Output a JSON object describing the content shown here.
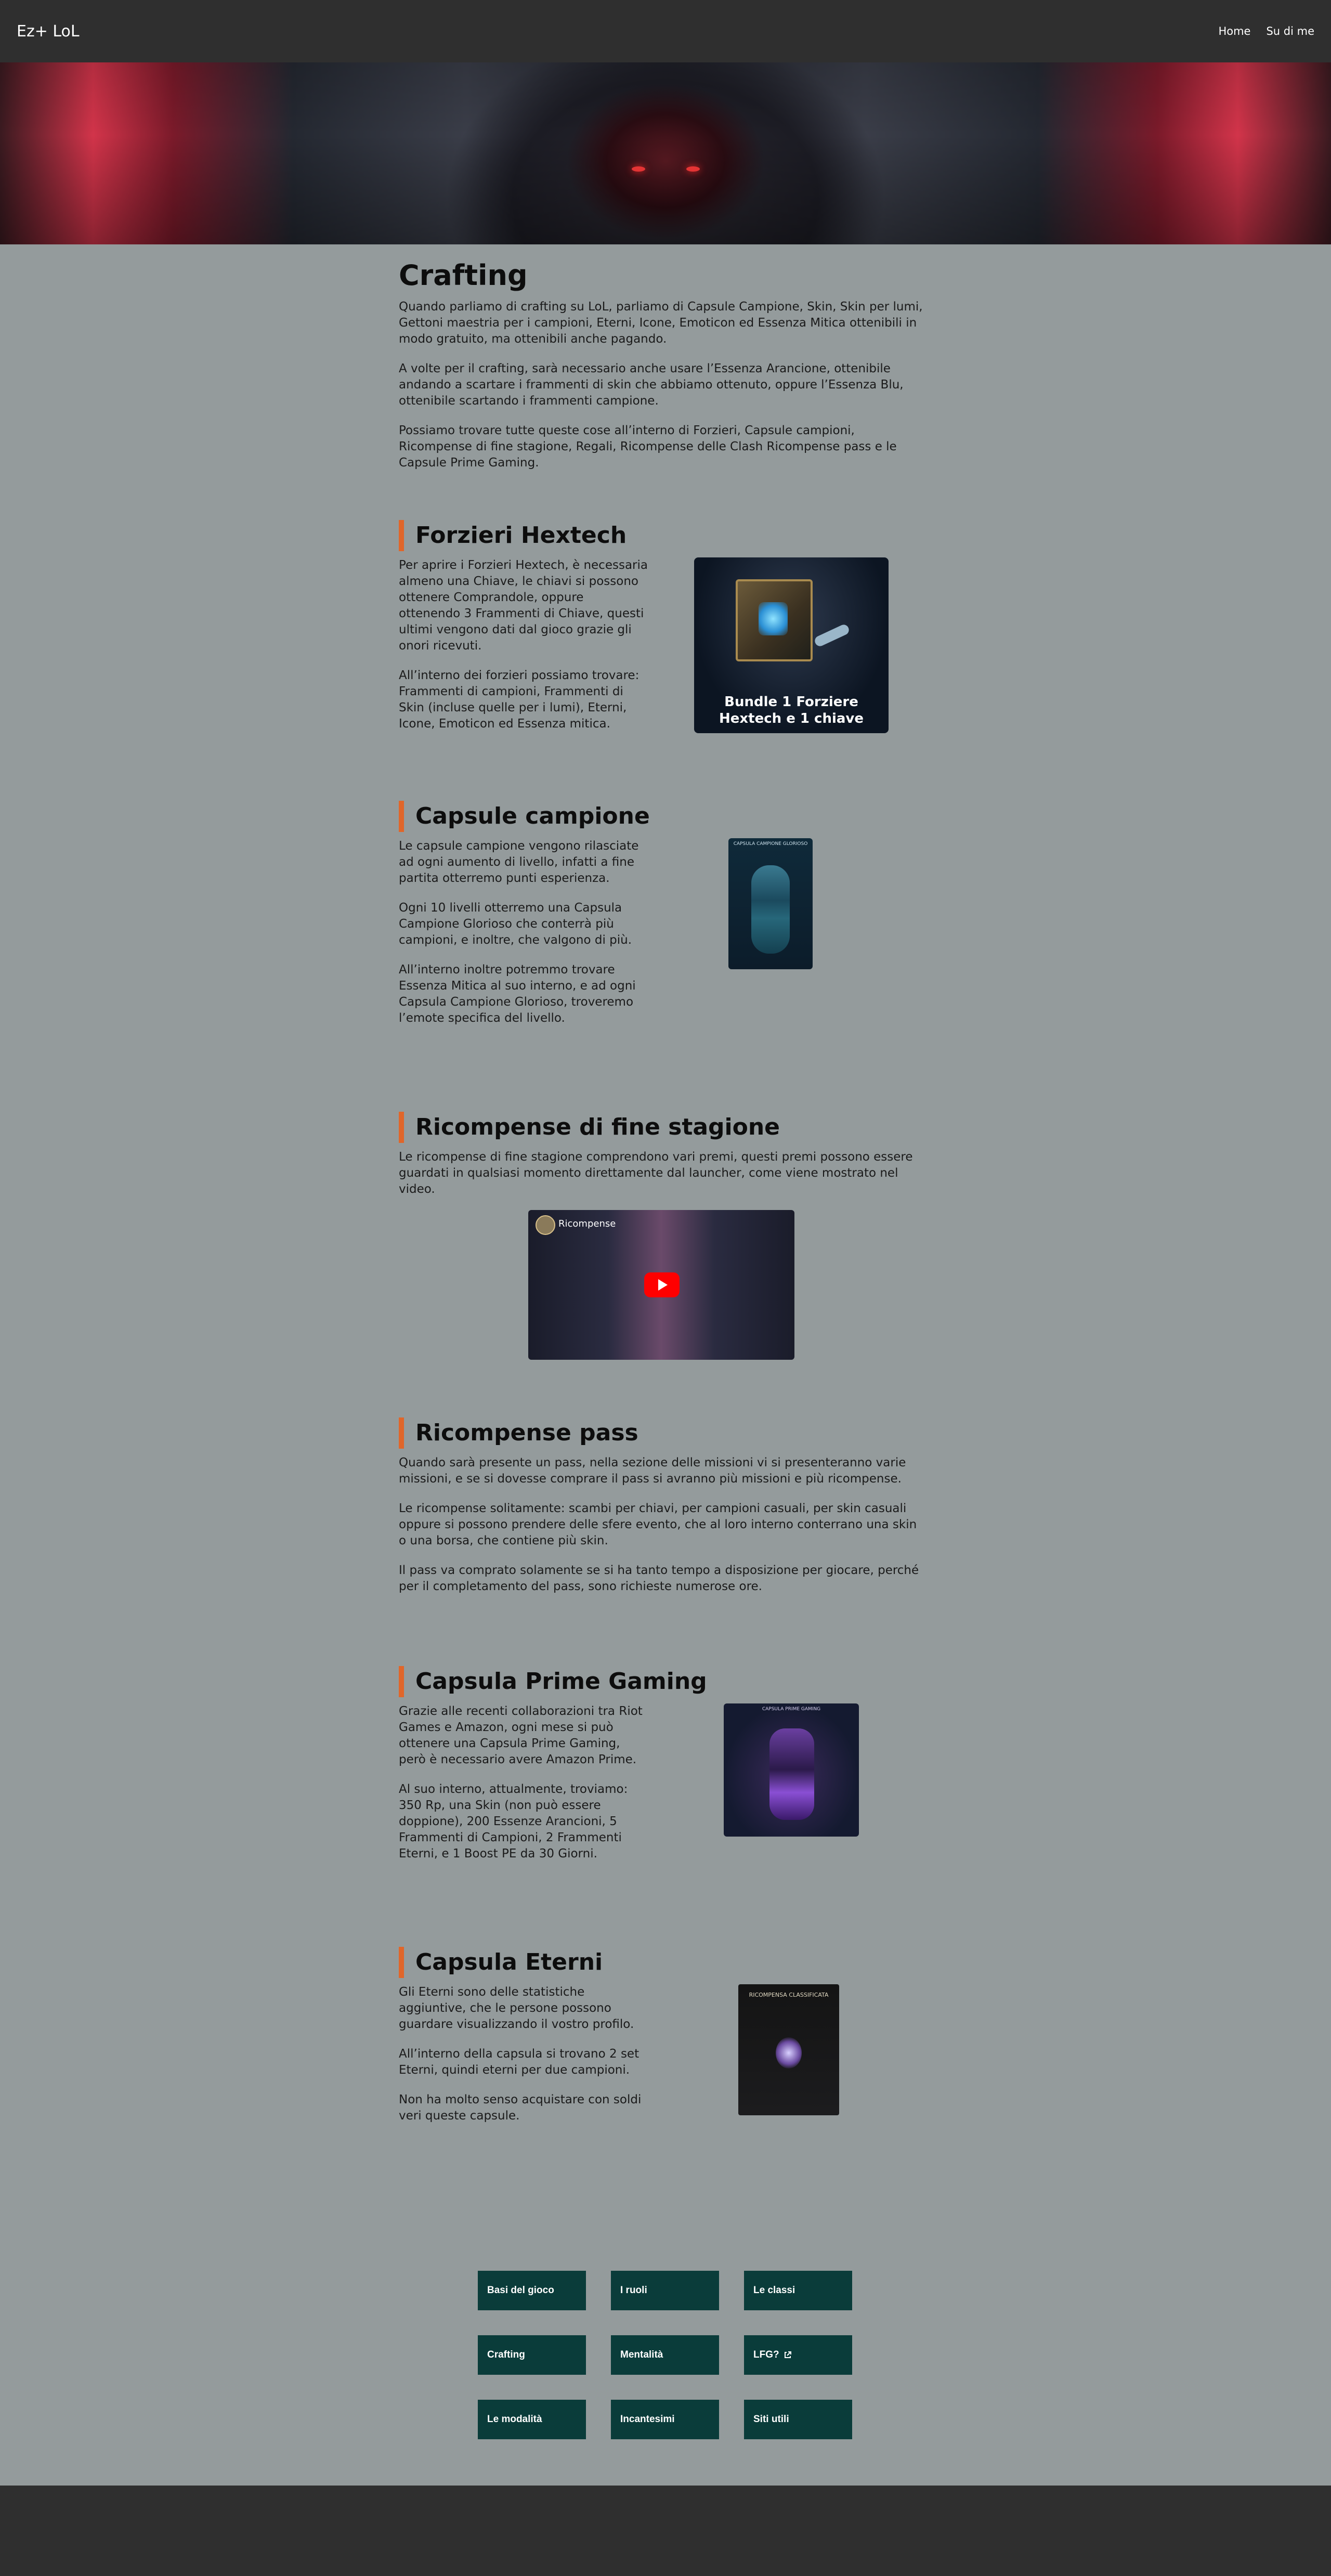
{
  "nav": {
    "brand": "Ez+ LoL",
    "links": [
      "Home",
      "Su di me"
    ]
  },
  "intro": {
    "title": "Crafting",
    "paragraphs": [
      "Quando parliamo di crafting su LoL, parliamo di Capsule Campione, Skin, Skin per lumi, Gettoni maestria per i campioni, Eterni, Icone, Emoticon ed Essenza Mitica ottenibili in modo gratuito, ma ottenibili anche pagando.",
      "A volte per il crafting, sarà necessario anche usare l’Essenza Arancione, ottenibile andando a scartare i frammenti di skin che abbiamo ottenuto, oppure l’Essenza Blu, ottenibile scartando i frammenti campione.",
      "Possiamo trovare tutte queste cose all’interno di Forzieri, Capsule campioni, Ricompense di fine stagione, Regali, Ricompense delle Clash Ricompense pass e le Capsule Prime Gaming."
    ]
  },
  "sections": {
    "forzieri": {
      "title": "Forzieri Hextech",
      "paragraphs": [
        "Per aprire i Forzieri Hextech, è necessaria almeno una Chiave, le chiavi si possono ottenere Comprandole, oppure ottenendo 3 Frammenti di Chiave, questi ultimi vengono dati dal gioco grazie gli onori ricevuti.",
        "All’interno dei forzieri possiamo trovare: Frammenti di campioni, Frammenti di Skin (incluse quelle per i lumi), Eterni, Icone, Emoticon ed Essenza mitica."
      ],
      "image_caption": "Bundle 1 Forziere Hextech e 1 chiave"
    },
    "capsule": {
      "title": "Capsule campione",
      "paragraphs": [
        "Le capsule campione vengono rilasciate ad ogni aumento di livello, infatti a fine partita otterremo punti esperienza.",
        "Ogni 10 livelli otterremo una Capsula Campione Glorioso che conterrà più campioni, e inoltre, che valgono di più.",
        "All’interno inoltre potremmo trovare Essenza Mitica al suo interno, e ad ogni Capsula Campione Glorioso, troveremo l’emote specifica del livello."
      ],
      "image_label": "CAPSULA CAMPIONE GLORIOSO"
    },
    "stagione": {
      "title": "Ricompense di fine stagione",
      "paragraphs": [
        "Le ricompense di fine stagione comprendono vari premi, questi premi possono essere guardati in qualsiasi momento direttamente dal launcher, come viene mostrato nel video."
      ],
      "video_title": "Ricompense"
    },
    "pass": {
      "title": "Ricompense pass",
      "paragraphs": [
        "Quando sarà presente un pass, nella sezione delle missioni vi si presenteranno varie missioni, e se si dovesse comprare il pass si avranno più missioni e più ricompense.",
        "Le ricompense solitamente: scambi per chiavi, per campioni casuali, per skin casuali oppure si possono prendere delle sfere evento, che al loro interno conterrano una skin o una borsa, che contiene più skin.",
        "Il pass va comprato solamente se si ha tanto tempo a disposizione per giocare, perché per il completamento del pass, sono richieste numerose ore."
      ]
    },
    "prime": {
      "title": "Capsula Prime Gaming",
      "paragraphs": [
        "Grazie alle recenti collaborazioni tra Riot Games e Amazon, ogni mese si può ottenere una Capsula Prime Gaming, però è necessario avere Amazon Prime.",
        "Al suo interno, attualmente, troviamo: 350 Rp, una Skin (non può essere doppione), 200 Essenze Arancioni, 5 Frammenti di Campioni, 2 Frammenti Eterni, e 1 Boost PE da 30 Giorni."
      ],
      "image_label": "CAPSULA PRIME GAMING"
    },
    "eterni": {
      "title": "Capsula Eterni",
      "paragraphs": [
        "Gli Eterni sono delle statistiche aggiuntive, che le persone possono guardare visualizzando il vostro profilo.",
        "All’interno della capsula si trovano 2 set Eterni, quindi eterni per due campioni.",
        "Non ha molto senso acquistare con soldi veri queste capsule."
      ],
      "image_label": "RICOMPENSA CLASSIFICATA"
    }
  },
  "link_grid": [
    "Basi del gioco",
    "I ruoli",
    "Le classi",
    "Crafting",
    "Mentalità",
    "LFG?",
    "Le modalità",
    "Incantesimi",
    "Siti utili"
  ],
  "colors": {
    "page_bg": "#949b9c",
    "nav_bg": "#2f2f2f",
    "accent_bar": "#e0662a",
    "grid_button_bg": "#0a3c3a"
  }
}
